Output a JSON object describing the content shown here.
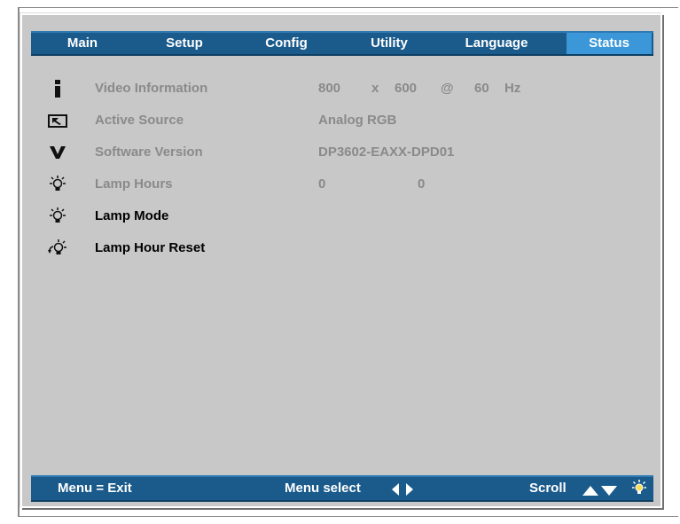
{
  "tabs": [
    {
      "label": "Main"
    },
    {
      "label": "Setup"
    },
    {
      "label": "Config"
    },
    {
      "label": "Utility"
    },
    {
      "label": "Language"
    },
    {
      "label": "Status"
    }
  ],
  "active_tab": "Status",
  "items": {
    "video_information": {
      "label": "Video Information",
      "width": "800",
      "x": "x",
      "height": "600",
      "at": "@",
      "refresh": "60",
      "unit": "Hz"
    },
    "active_source": {
      "label": "Active Source",
      "value": "Analog RGB"
    },
    "software_version": {
      "label": "Software Version",
      "value": "DP3602-EAXX-DPD01"
    },
    "lamp_hours": {
      "label": "Lamp Hours",
      "value1": "0",
      "value2": "0"
    },
    "lamp_mode": {
      "label": "Lamp Mode"
    },
    "lamp_hour_reset": {
      "label": "Lamp Hour Reset"
    }
  },
  "footer": {
    "exit": "Menu = Exit",
    "menu_select": "Menu select",
    "scroll": "Scroll"
  },
  "colors": {
    "bar": "#1a5b8c",
    "active_tab": "#3b97d8",
    "panel": "#c8c8c8"
  }
}
